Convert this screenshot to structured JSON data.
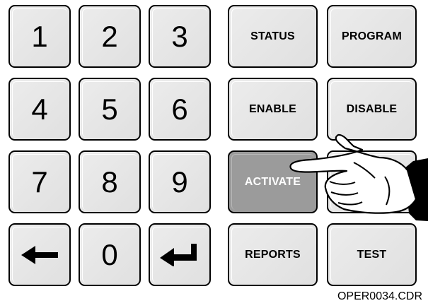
{
  "keypad": {
    "digits": [
      "1",
      "2",
      "3",
      "4",
      "5",
      "6",
      "7",
      "8",
      "9",
      "0"
    ],
    "back_icon": "left-arrow-icon",
    "enter_icon": "enter-arrow-icon"
  },
  "function_keys": {
    "status": "STATUS",
    "program": "PROGRAM",
    "enable": "ENABLE",
    "disable": "DISABLE",
    "activate": "ACTIVATE",
    "reports": "REPORTS",
    "test": "TEST",
    "active_key": "ACTIVATE",
    "active_color": "#9b9b9b"
  },
  "pointer_icon": "pointing-hand-icon",
  "caption": "OPER0034.CDR"
}
